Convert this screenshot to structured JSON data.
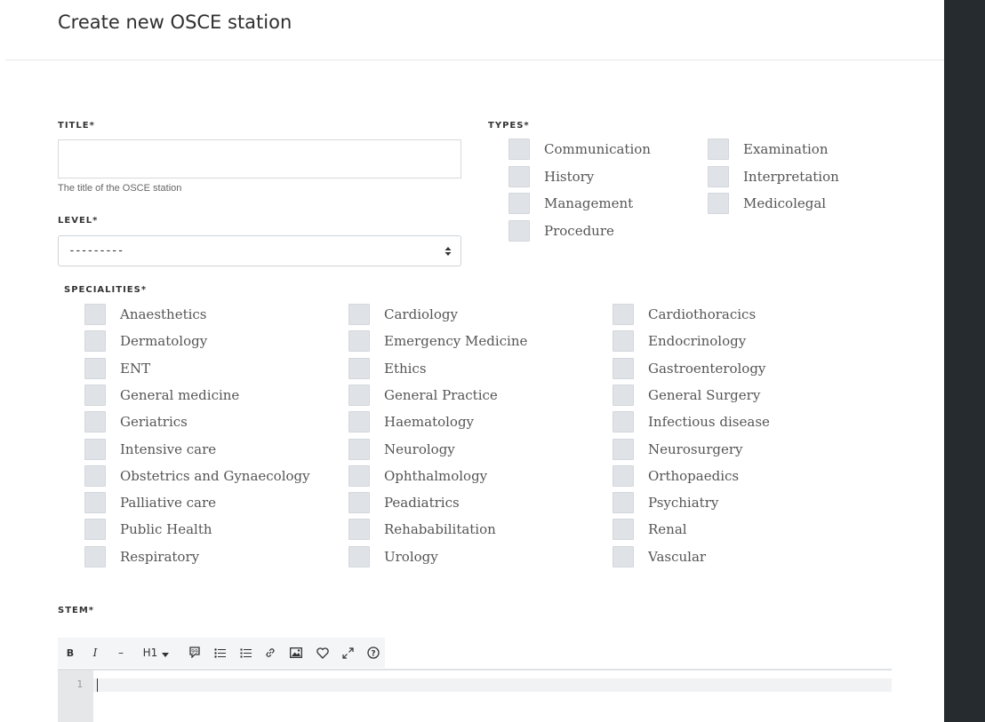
{
  "page": {
    "title": "Create new OSCE station"
  },
  "form": {
    "title_label": "TITLE*",
    "title_value": "",
    "title_help": "The title of the OSCE station",
    "level_label": "LEVEL*",
    "level_selected": "---------",
    "types_label": "TYPES*",
    "types": [
      "Communication",
      "Examination",
      "History",
      "Interpretation",
      "Management",
      "Medicolegal",
      "Procedure"
    ],
    "specialities_label": "SPECIALITIES*",
    "specialities": [
      "Anaesthetics",
      "Cardiology",
      "Cardiothoracics",
      "Dermatology",
      "Emergency Medicine",
      "Endocrinology",
      "ENT",
      "Ethics",
      "Gastroenterology",
      "General medicine",
      "General Practice",
      "General Surgery",
      "Geriatrics",
      "Haematology",
      "Infectious disease",
      "Intensive care",
      "Neurology",
      "Neurosurgery",
      "Obstetrics and Gynaecology",
      "Ophthalmology",
      "Orthopaedics",
      "Palliative care",
      "Peadiatrics",
      "Psychiatry",
      "Public Health",
      "Rehababilitation",
      "Renal",
      "Respiratory",
      "Urology",
      "Vascular"
    ],
    "stem_label": "STEM*"
  },
  "editor": {
    "toolbar": [
      {
        "name": "bold-button",
        "icon": "bold-icon",
        "glyph": "B"
      },
      {
        "name": "italic-button",
        "icon": "italic-icon",
        "glyph": "I"
      },
      {
        "name": "strikethrough-button",
        "icon": "strikethrough-icon",
        "glyph": "–"
      },
      {
        "name": "heading-button",
        "icon": "heading-icon",
        "glyph": "H1"
      },
      {
        "name": "quote-button",
        "icon": "quote-icon",
        "glyph": ""
      },
      {
        "name": "bullet-list-button",
        "icon": "bullet-list-icon",
        "glyph": ""
      },
      {
        "name": "numbered-list-button",
        "icon": "numbered-list-icon",
        "glyph": ""
      },
      {
        "name": "link-button",
        "icon": "link-icon",
        "glyph": ""
      },
      {
        "name": "image-button",
        "icon": "image-icon",
        "glyph": ""
      },
      {
        "name": "favorite-button",
        "icon": "heart-icon",
        "glyph": ""
      },
      {
        "name": "fullscreen-button",
        "icon": "expand-icon",
        "glyph": ""
      },
      {
        "name": "help-button",
        "icon": "help-icon",
        "glyph": ""
      }
    ],
    "line_number": "1"
  },
  "colors": {
    "background_dark": "#22272b",
    "checkbox": "#dfe2e6",
    "toolbar": "#f3f5f7"
  }
}
